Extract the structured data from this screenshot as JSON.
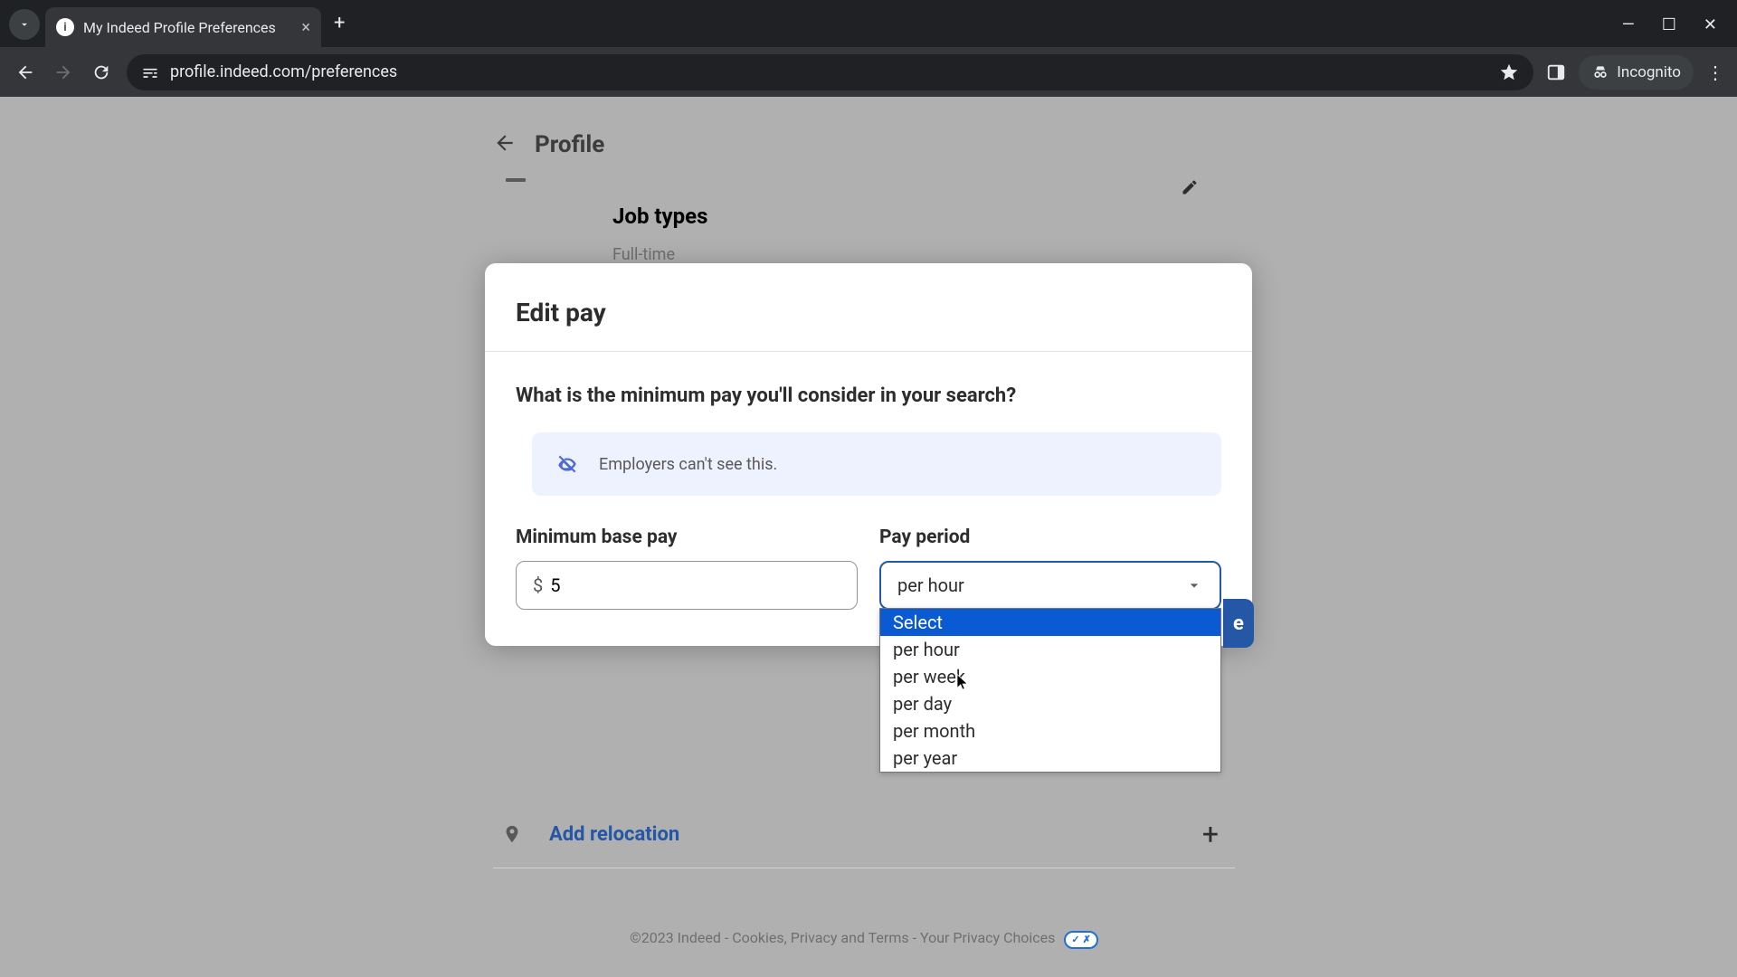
{
  "browser": {
    "tab_title": "My Indeed Profile Preferences",
    "url": "profile.indeed.com/preferences",
    "incognito_label": "Incognito"
  },
  "page": {
    "back_label": "Profile",
    "section_title": "Job types",
    "section_value": "Full-time",
    "add_relocation_label": "Add relocation",
    "footer_copyright": "©2023 Indeed - ",
    "footer_link1": "Cookies, Privacy and Terms",
    "footer_sep": " - ",
    "footer_link2": "Your Privacy Choices"
  },
  "modal": {
    "title": "Edit pay",
    "question": "What is the minimum pay you'll consider in your search?",
    "info_text": "Employers can't see this.",
    "min_pay_label": "Minimum base pay",
    "min_pay_prefix": "$",
    "min_pay_value": "5",
    "period_label": "Pay period",
    "period_selected": "per hour",
    "options": {
      "o0": "Select",
      "o1": "per hour",
      "o2": "per week",
      "o3": "per day",
      "o4": "per month",
      "o5": "per year"
    },
    "save_fragment": "e"
  }
}
